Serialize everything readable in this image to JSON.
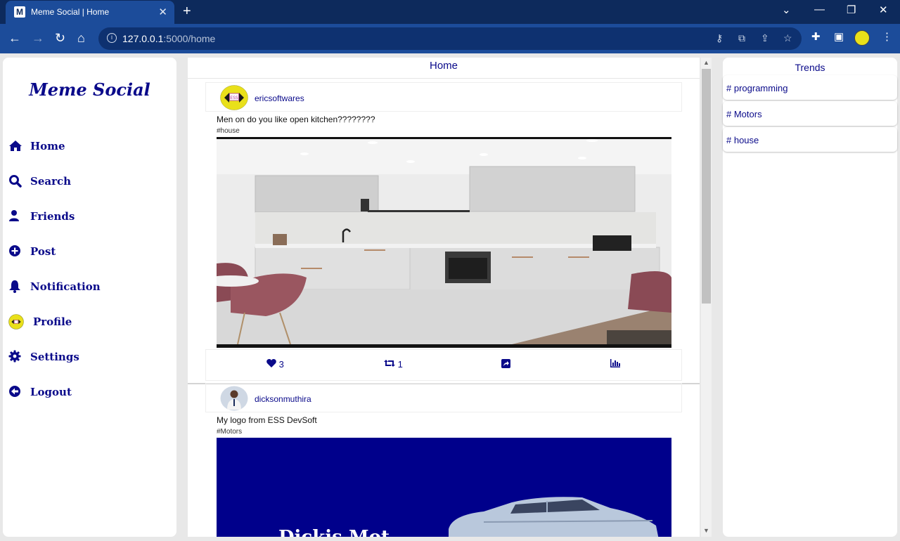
{
  "browser": {
    "tab_title": "Meme Social | Home",
    "favicon_letter": "M",
    "url_host": "127.0.0.1",
    "url_path": ":5000/home",
    "accent": "#1c4c9a",
    "titlebar_color": "#0d2a5c"
  },
  "app": {
    "brand": "Meme Social",
    "text_color": "#0a0a8a"
  },
  "sidebar": {
    "items": [
      {
        "label": "Home",
        "icon": "home-icon"
      },
      {
        "label": "Search",
        "icon": "search-icon"
      },
      {
        "label": "Friends",
        "icon": "user-icon"
      },
      {
        "label": "Post",
        "icon": "plus-circle-icon"
      },
      {
        "label": "Notification",
        "icon": "bell-icon"
      },
      {
        "label": "Profile",
        "icon": "profile-avatar-icon"
      },
      {
        "label": "Settings",
        "icon": "gear-icon"
      },
      {
        "label": "Logout",
        "icon": "logout-arrow-icon"
      }
    ]
  },
  "feed": {
    "title": "Home",
    "posts": [
      {
        "username": "ericsoftwares",
        "avatar_badge": "ESS",
        "text": "Men on do you like open kitchen????????",
        "tag": "#house",
        "likes": "3",
        "retweets": "1",
        "image": "kitchen-photo"
      },
      {
        "username": "dicksonmuthira",
        "text": "My logo from ESS DevSoft",
        "tag": "#Motors",
        "image": "car-logo-image",
        "image_text": "Dickis Mot"
      }
    ]
  },
  "trends": {
    "title": "Trends",
    "items": [
      "# programming",
      "# Motors",
      "# house"
    ]
  }
}
